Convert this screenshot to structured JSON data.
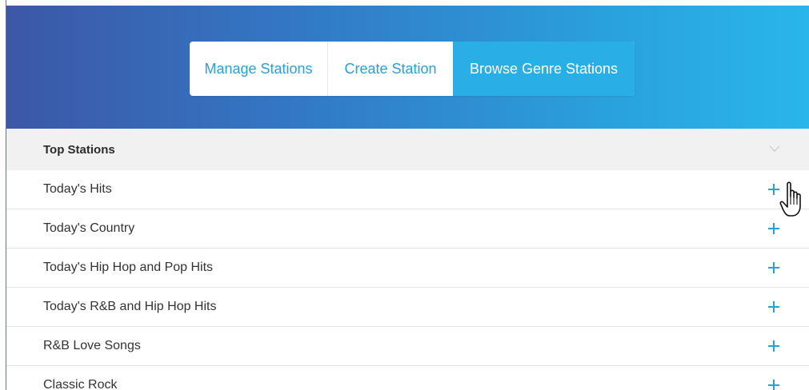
{
  "tabs": {
    "manage": "Manage Stations",
    "create": "Create Station",
    "browse": "Browse Genre Stations",
    "active": "browse"
  },
  "section": {
    "title": "Top Stations",
    "toggle_icon": "chevron-down-icon"
  },
  "stations": [
    {
      "name": "Today's Hits",
      "action_icon": "plus-icon"
    },
    {
      "name": "Today's Country",
      "action_icon": "plus-icon"
    },
    {
      "name": "Today's Hip Hop and Pop Hits",
      "action_icon": "plus-icon"
    },
    {
      "name": "Today's R&B and Hip Hop Hits",
      "action_icon": "plus-icon"
    },
    {
      "name": "R&B Love Songs",
      "action_icon": "plus-icon"
    },
    {
      "name": "Classic Rock",
      "action_icon": "plus-icon"
    }
  ],
  "colors": {
    "accent": "#29aee6",
    "hero_start": "#3c57a6",
    "hero_end": "#29b6ea",
    "plus": "#2a9fd8"
  }
}
